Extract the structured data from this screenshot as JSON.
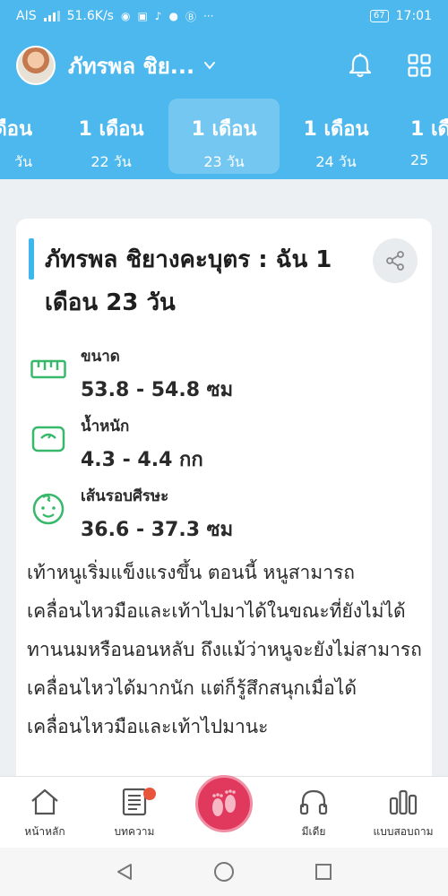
{
  "status_bar": {
    "carrier": "AIS",
    "network_speed": "51.6K/s",
    "battery": "67",
    "time": "17:01",
    "icons": [
      "messenger-icon",
      "calendar-icon",
      "tiktok-icon",
      "facebook-icon",
      "b-icon",
      "more-dots-icon"
    ]
  },
  "header": {
    "profile_name": "ภัทรพล ชิย...",
    "bell_icon": "bell-icon",
    "grid_icon": "grid-icon"
  },
  "age_tabs": [
    {
      "month": "เดือน",
      "days": "วัน",
      "active": false
    },
    {
      "month": "1 เดือน",
      "days": "22 วัน",
      "active": false
    },
    {
      "month": "1 เดือน",
      "days": "23 วัน",
      "active": true
    },
    {
      "month": "1 เดือน",
      "days": "24 วัน",
      "active": false
    },
    {
      "month": "1 เดื",
      "days": "25",
      "active": false
    }
  ],
  "card": {
    "title": "ภัทรพล ชิยางคะบุตร : ฉัน 1 เดือน 23 วัน",
    "metrics": [
      {
        "label": "ขนาด",
        "value": "53.8 - 54.8 ซม",
        "icon": "ruler-icon"
      },
      {
        "label": "น้ำหนัก",
        "value": "4.3 - 4.4 กก",
        "icon": "scale-icon"
      },
      {
        "label": "เส้นรอบศีรษะ",
        "value": "36.6 - 37.3 ซม",
        "icon": "baby-face-icon"
      }
    ],
    "description": "เท้าหนูเริ่มแข็งแรงขึ้น ตอนนี้ หนูสามารถเคลื่อนไหวมือและเท้าไปมาได้ในขณะที่ยังไม่ได้ทานนมหรือนอนหลับ ถึงแม้ว่าหนูจะยังไม่สามารถเคลื่อนไหวได้มากนัก แต่ก็รู้สึกสนุกเมื่อได้เคลื่อนไหวมือและเท้าไปมานะ"
  },
  "bottom_nav": [
    {
      "label": "หน้าหลัก",
      "icon": "home-icon"
    },
    {
      "label": "บทความ",
      "icon": "article-icon",
      "badge": true
    },
    {
      "label": "",
      "icon": "baby-feet-icon"
    },
    {
      "label": "มีเดีย",
      "icon": "headphones-icon"
    },
    {
      "label": "แบบสอบถาม",
      "icon": "survey-bars-icon"
    }
  ],
  "colors": {
    "header": "#4db8ee",
    "accent": "#3eb6ee",
    "metric_icon": "#38b86b",
    "center_button": "#e0395d",
    "badge": "#e8553b"
  }
}
